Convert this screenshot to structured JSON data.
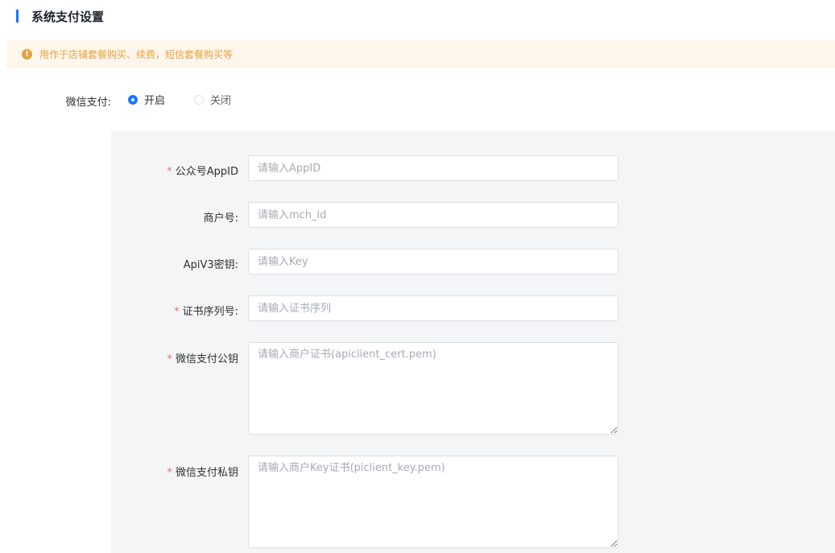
{
  "section": {
    "title": "系统支付设置"
  },
  "notice": {
    "icon": "!",
    "text": "用作于店铺套餐购买、续费，短信套餐购买等"
  },
  "wechat_pay": {
    "label": "微信支付:",
    "options": [
      {
        "label": "开启",
        "checked": true
      },
      {
        "label": "关闭",
        "checked": false
      }
    ]
  },
  "form": {
    "required_mark": "*",
    "appid": {
      "label": "公众号AppID",
      "placeholder": "请输入AppID"
    },
    "mch_id": {
      "label": "商户号:",
      "placeholder": "请输入mch_id"
    },
    "apiv3_key": {
      "label": "ApiV3密钥:",
      "placeholder": "请输入Key"
    },
    "cert_serial": {
      "label": "证书序列号:",
      "placeholder": "请输入证书序列"
    },
    "public_key": {
      "label": "微信支付公钥",
      "placeholder": "请输入商户证书(apiclient_cert.pem)"
    },
    "private_key": {
      "label": "微信支付私钥",
      "placeholder": "请输入商户Key证书(piclient_key.pem)"
    }
  },
  "colors": {
    "accent": "#1677ff",
    "warning": "#e6a23c",
    "warning_bg": "#fdf6ec",
    "required": "#f56c6c",
    "panel_bg": "#f4f5f7"
  }
}
